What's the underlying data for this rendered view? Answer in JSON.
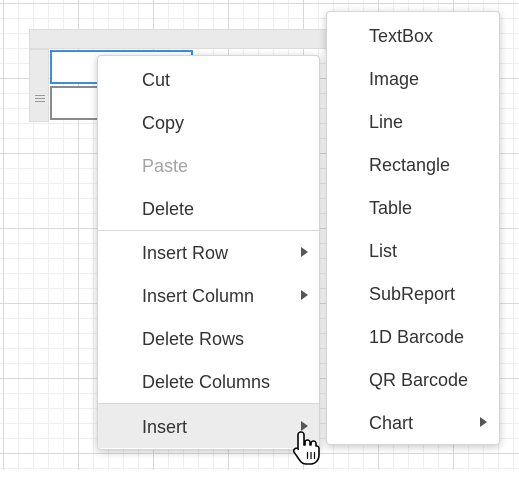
{
  "context_menu": {
    "items": [
      {
        "label": "Cut",
        "enabled": true,
        "submenu": false
      },
      {
        "label": "Copy",
        "enabled": true,
        "submenu": false
      },
      {
        "label": "Paste",
        "enabled": false,
        "submenu": false
      },
      {
        "label": "Delete",
        "enabled": true,
        "submenu": false
      },
      {
        "label": "Insert Row",
        "enabled": true,
        "submenu": true
      },
      {
        "label": "Insert Column",
        "enabled": true,
        "submenu": true
      },
      {
        "label": "Delete Rows",
        "enabled": true,
        "submenu": false
      },
      {
        "label": "Delete Columns",
        "enabled": true,
        "submenu": false
      },
      {
        "label": "Insert",
        "enabled": true,
        "submenu": true,
        "highlighted": true
      }
    ]
  },
  "insert_submenu": {
    "items": [
      {
        "label": "TextBox",
        "submenu": false
      },
      {
        "label": "Image",
        "submenu": false
      },
      {
        "label": "Line",
        "submenu": false
      },
      {
        "label": "Rectangle",
        "submenu": false
      },
      {
        "label": "Table",
        "submenu": false
      },
      {
        "label": "List",
        "submenu": false
      },
      {
        "label": "SubReport",
        "submenu": false
      },
      {
        "label": "1D Barcode",
        "submenu": false
      },
      {
        "label": "QR Barcode",
        "submenu": false
      },
      {
        "label": "Chart",
        "submenu": true
      }
    ]
  },
  "colors": {
    "selection_border": "#3b8fd9",
    "menu_hover": "#ececec",
    "disabled_text": "#a3a3a3"
  },
  "icons": {
    "row_handle": "grip-lines-icon",
    "submenu_indicator": "chevron-right-icon",
    "cursor": "hand-pointer-icon"
  }
}
